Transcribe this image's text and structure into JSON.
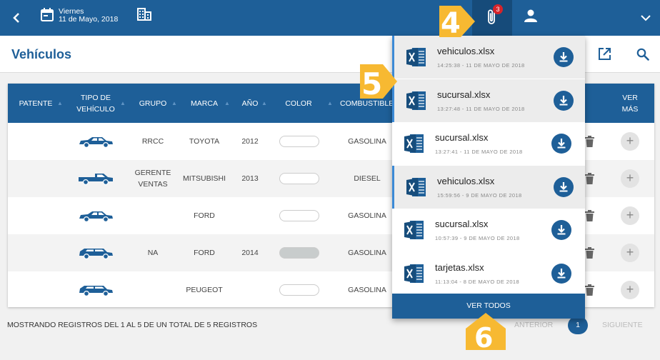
{
  "header": {
    "day": "Viernes",
    "date": "11 de Mayo, 2018",
    "notif_count": "3",
    "icons": [
      "back-arrow-icon",
      "calendar-icon",
      "building-icon",
      "paperclip-icon",
      "user-icon",
      "chevron-down-icon"
    ]
  },
  "page": {
    "title": "Vehículos",
    "icons": [
      "external-link-icon",
      "search-icon"
    ]
  },
  "table": {
    "headers": {
      "patente": "PATENTE",
      "tipo1": "TIPO DE",
      "tipo2": "VEHÍCULO",
      "grupo": "GRUPO",
      "marca": "MARCA",
      "anio": "AÑO",
      "color": "COLOR",
      "combustible": "COMBUSTIBLE",
      "ver1": "VER",
      "ver2": "MÁS"
    },
    "rows": [
      {
        "patente": "",
        "tipo": "sedan",
        "grupo1": "RRCC",
        "grupo2": "",
        "marca": "TOYOTA",
        "anio": "2012",
        "color": "#ffffff",
        "combustible": "GASOLINA"
      },
      {
        "patente": "",
        "tipo": "pickup",
        "grupo1": "GERENTE",
        "grupo2": "VENTAS",
        "marca": "MITSUBISHI",
        "anio": "2013",
        "color": "#ffffff",
        "combustible": "DIESEL"
      },
      {
        "patente": "",
        "tipo": "sedan",
        "grupo1": "",
        "grupo2": "",
        "marca": "FORD",
        "anio": "",
        "color": "#ffffff",
        "combustible": "GASOLINA"
      },
      {
        "patente": "",
        "tipo": "wagon",
        "grupo1": "NA",
        "grupo2": "",
        "marca": "FORD",
        "anio": "2014",
        "color": "#c8cccc",
        "combustible": "GASOLINA"
      },
      {
        "patente": "",
        "tipo": "wagon",
        "grupo1": "",
        "grupo2": "",
        "marca": "PEUGEOT",
        "anio": "",
        "color": "#ffffff",
        "combustible": "GASOLINA"
      }
    ]
  },
  "footer": {
    "showing": "MOSTRANDO REGISTROS DEL 1 AL 5 DE UN TOTAL DE 5 REGISTROS",
    "prev": "ANTERIOR",
    "page": "1",
    "next": "SIGUIENTE"
  },
  "attachments": {
    "items": [
      {
        "name": "vehiculos.xlsx",
        "date": "14:25:38 - 11 DE MAYO DE 2018",
        "highlighted": true
      },
      {
        "name": "sucursal.xlsx",
        "date": "13:27:48 - 11 DE MAYO DE 2018",
        "highlighted": true
      },
      {
        "name": "sucursal.xlsx",
        "date": "13:27:41 - 11 DE MAYO DE 2018",
        "highlighted": false
      },
      {
        "name": "vehiculos.xlsx",
        "date": "15:59:56 - 9 DE MAYO DE 2018",
        "highlighted": true
      },
      {
        "name": "sucursal.xlsx",
        "date": "10:57:39 - 9 DE MAYO DE 2018",
        "highlighted": false
      },
      {
        "name": "tarjetas.xlsx",
        "date": "11:13:04 - 8 DE MAYO DE 2018",
        "highlighted": false
      }
    ],
    "ver_todos": "VER TODOS"
  },
  "callouts": [
    "4",
    "5",
    "6"
  ],
  "colors": {
    "primary": "#1e5f98",
    "callout": "#f7b932",
    "badge": "#d6242b",
    "excel": "#1e5f98"
  }
}
